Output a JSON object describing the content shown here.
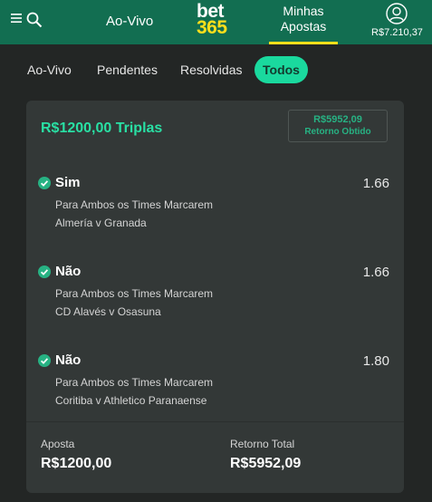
{
  "header": {
    "nav_live": "Ao-Vivo",
    "logo_top": "bet",
    "logo_bottom": "365",
    "my_bets_line1": "Minhas",
    "my_bets_line2": "Apostas",
    "balance": "R$7.210,37"
  },
  "tabs": [
    {
      "label": "Ao-Vivo"
    },
    {
      "label": "Pendentes"
    },
    {
      "label": "Resolvidas"
    },
    {
      "label": "Todos"
    }
  ],
  "bet": {
    "title": "R$1200,00 Triplas",
    "return_amount": "R$5952,09",
    "return_label": "Retorno Obtido",
    "selections": [
      {
        "name": "Sim",
        "odds": "1.66",
        "market": "Para Ambos os Times Marcarem",
        "event": "Almería v Granada"
      },
      {
        "name": "Não",
        "odds": "1.66",
        "market": "Para Ambos os Times Marcarem",
        "event": "CD Alavés v Osasuna"
      },
      {
        "name": "Não",
        "odds": "1.80",
        "market": "Para Ambos os Times Marcarem",
        "event": "Coritiba v Athletico Paranaense"
      }
    ],
    "stake_label": "Aposta",
    "stake_value": "R$1200,00",
    "total_return_label": "Retorno Total",
    "total_return_value": "R$5952,09"
  },
  "colors": {
    "header_bg": "#126e51",
    "accent": "#1ad99e",
    "logo_yellow": "#ffdf1b",
    "win_check": "#27b283"
  }
}
